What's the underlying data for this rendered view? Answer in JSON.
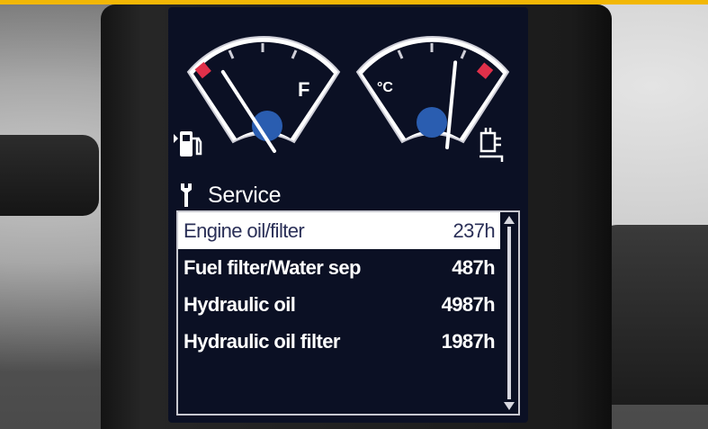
{
  "colors": {
    "screen_bg": "#0b1024",
    "gauge_red": "#e0304a",
    "needle_hub": "#2a5db0",
    "text": "#ffffff",
    "selected_text": "#2a2f57",
    "machine_yellow": "#f2b705"
  },
  "gauges": {
    "fuel": {
      "label": "F",
      "icon": "fuel-pump-icon",
      "level": 0.2
    },
    "temperature": {
      "label": "°C",
      "icon": "engine-oil-temperature-icon",
      "level": 0.55
    }
  },
  "service": {
    "title": "Service",
    "icon": "wrench-icon",
    "items": [
      {
        "name": "Engine oil/filter",
        "value": "237h",
        "selected": true
      },
      {
        "name": "Fuel filter/Water sep",
        "value": "487h",
        "selected": false
      },
      {
        "name": "Hydraulic oil",
        "value": "4987h",
        "selected": false
      },
      {
        "name": "Hydraulic oil filter",
        "value": "1987h",
        "selected": false
      }
    ]
  }
}
